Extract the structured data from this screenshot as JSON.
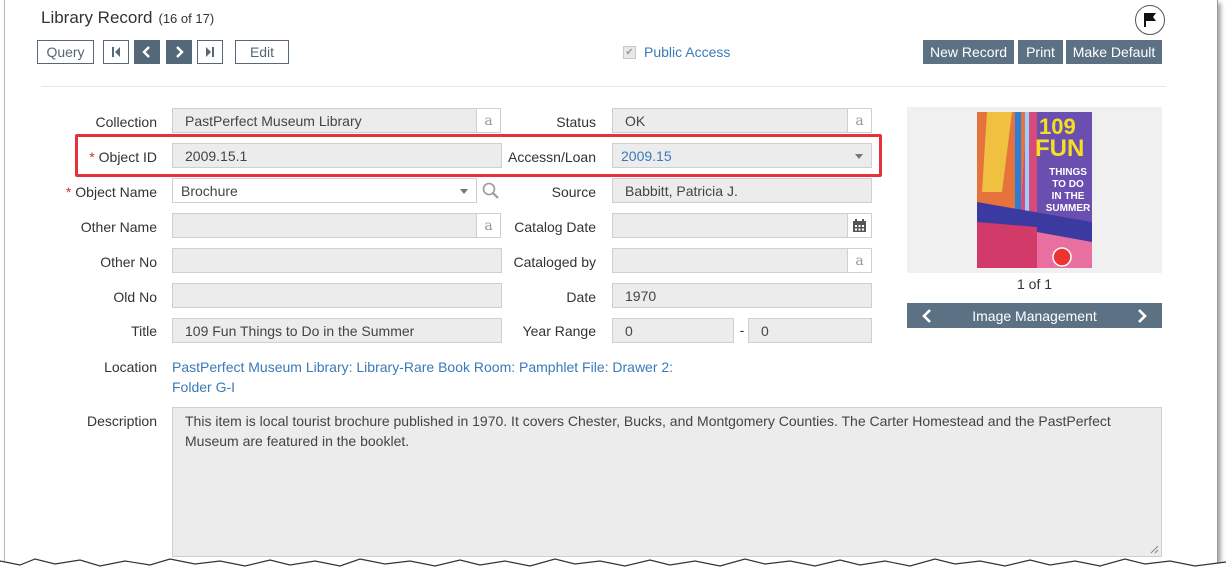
{
  "header": {
    "title": "Library Record",
    "record_count": "(16 of 17)"
  },
  "toolbar": {
    "query_label": "Query",
    "edit_label": "Edit",
    "public_access_label": "Public Access",
    "public_access_checked": true,
    "new_record_label": "New Record",
    "print_label": "Print",
    "make_default_label": "Make Default"
  },
  "fields": {
    "collection": {
      "label": "Collection",
      "value": "PastPerfect Museum Library"
    },
    "object_id": {
      "label": "Object ID",
      "value": "2009.15.1"
    },
    "object_name": {
      "label": "Object Name",
      "value": "Brochure"
    },
    "other_name": {
      "label": "Other Name",
      "value": ""
    },
    "other_no": {
      "label": "Other No",
      "value": ""
    },
    "old_no": {
      "label": "Old No",
      "value": ""
    },
    "title": {
      "label": "Title",
      "value": "109 Fun Things to Do in the Summer"
    },
    "status": {
      "label": "Status",
      "value": "OK"
    },
    "accessn_loan": {
      "label": "Accessn/Loan",
      "value": "2009.15"
    },
    "source": {
      "label": "Source",
      "value": "Babbitt, Patricia J."
    },
    "catalog_date": {
      "label": "Catalog Date",
      "value": ""
    },
    "cataloged_by": {
      "label": "Cataloged by",
      "value": ""
    },
    "date": {
      "label": "Date",
      "value": "1970"
    },
    "year_range": {
      "label": "Year Range",
      "from": "0",
      "to": "0",
      "separator": "-"
    },
    "location": {
      "label": "Location",
      "line1": "PastPerfect Museum Library: Library-Rare Book Room: Pamphlet File: Drawer 2:",
      "line2": "Folder G-I"
    },
    "description": {
      "label": "Description",
      "value": "This item is local tourist brochure published in 1970. It covers Chester, Bucks, and Montgomery Counties. The Carter Homestead and the PastPerfect Museum are featured in the booklet."
    }
  },
  "required_marker": "*",
  "abc_glyph": "a",
  "image": {
    "cover_title_top": "109",
    "cover_title_mid": "FUN",
    "cover_subtitle": [
      "THINGS",
      "TO DO",
      "IN THE",
      "SUMMER"
    ],
    "count": "1 of 1",
    "management_label": "Image Management"
  },
  "colors": {
    "accent_link": "#3a7ab8",
    "button_dark": "#5d7185",
    "highlight_red": "#e5323b",
    "required_red": "#c0392b"
  },
  "icons": [
    "flag-icon",
    "first-record-icon",
    "prev-record-icon",
    "next-record-icon",
    "last-record-icon",
    "search-icon",
    "calendar-icon",
    "chevron-left-icon",
    "chevron-right-icon"
  ]
}
